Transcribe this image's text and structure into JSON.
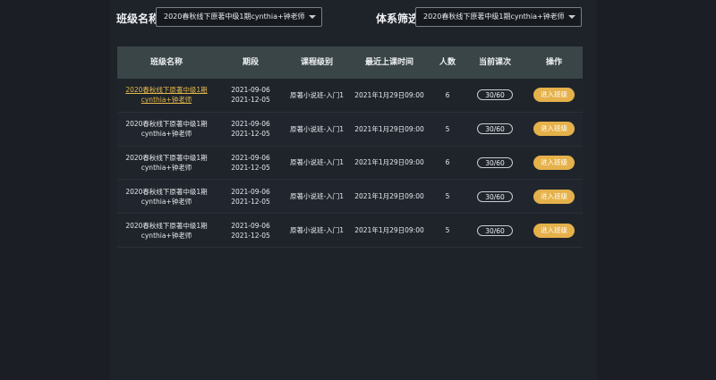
{
  "filters": {
    "class_label": "班级名称",
    "class_value": "2020春秋线下原著中级1期cynthia+钟老师",
    "system_label": "体系筛选",
    "system_value": "2020春秋线下原著中级1期cynthia+钟老师"
  },
  "table": {
    "headers": [
      "班级名称",
      "期段",
      "课程级别",
      "最近上课时间",
      "人数",
      "当前课次",
      "操作"
    ],
    "rows": [
      {
        "name1": "2020春秋线下原著中级1期",
        "name2": "cynthia+钟老师",
        "start": "2021-09-06",
        "end": "2021-12-05",
        "level": "原著小说班-入门1",
        "last": "2021年1月29日09:00",
        "count": "6",
        "lesson": "30/60",
        "action": "进入班级"
      },
      {
        "name1": "2020春秋线下原著中级1期",
        "name2": "cynthia+钟老师",
        "start": "2021-09-06",
        "end": "2021-12-05",
        "level": "原著小说班-入门1",
        "last": "2021年1月29日09:00",
        "count": "5",
        "lesson": "30/60",
        "action": "进入班级"
      },
      {
        "name1": "2020春秋线下原著中级1期",
        "name2": "cynthia+钟老师",
        "start": "2021-09-06",
        "end": "2021-12-05",
        "level": "原著小说班-入门1",
        "last": "2021年1月29日09:00",
        "count": "6",
        "lesson": "30/60",
        "action": "进入班级"
      },
      {
        "name1": "2020春秋线下原著中级1期",
        "name2": "cynthia+钟老师",
        "start": "2021-09-06",
        "end": "2021-12-05",
        "level": "原著小说班-入门1",
        "last": "2021年1月29日09:00",
        "count": "5",
        "lesson": "30/60",
        "action": "进入班级"
      },
      {
        "name1": "2020春秋线下原著中级1期",
        "name2": "cynthia+钟老师",
        "start": "2021-09-06",
        "end": "2021-12-05",
        "level": "原著小说班-入门1",
        "last": "2021年1月29日09:00",
        "count": "5",
        "lesson": "30/60",
        "action": "进入班级"
      }
    ]
  },
  "colors": {
    "accent": "#e5b14a",
    "link": "#e5b84a",
    "header_bg": "#3a4547",
    "page_bg": "#1b1f25"
  }
}
